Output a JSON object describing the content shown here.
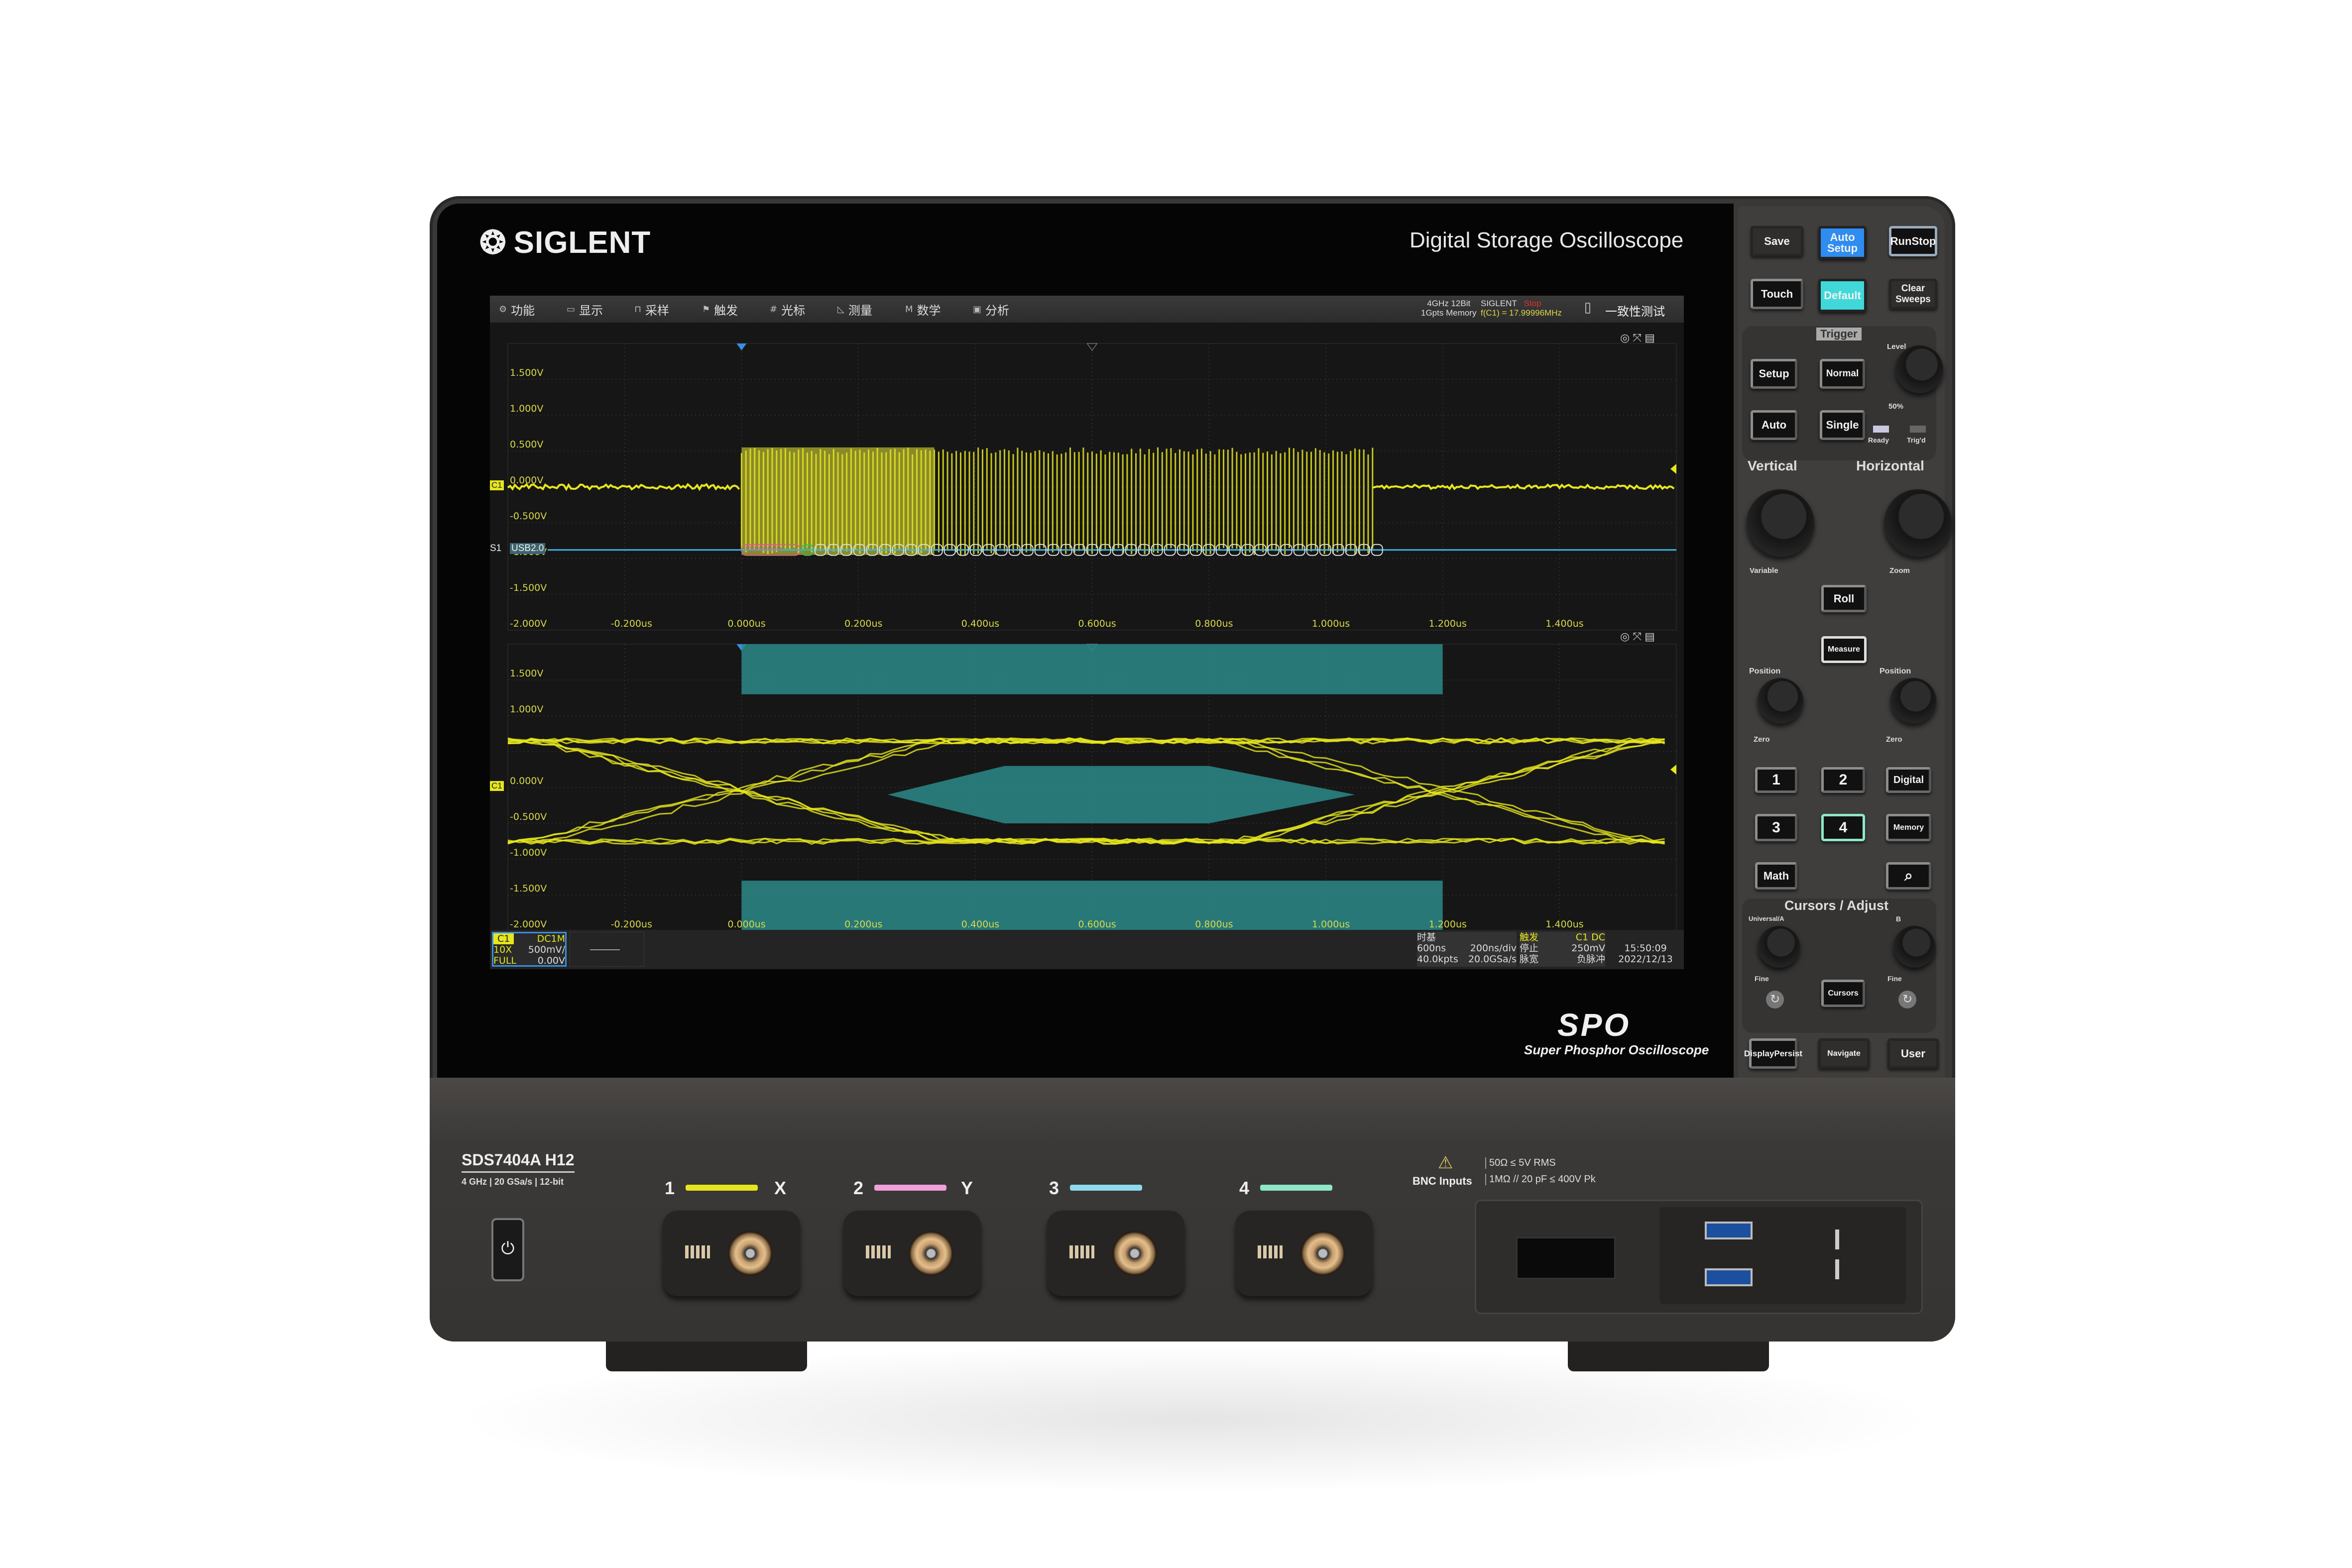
{
  "brand": {
    "logo": "SIGLENT",
    "product_line": "Digital Storage Oscilloscope",
    "spo_logo": "SPO",
    "spo_tagline": "Super Phosphor Oscilloscope"
  },
  "menu": [
    {
      "icon": "gear-icon",
      "glyph": "⚙",
      "label": "功能"
    },
    {
      "icon": "display-icon",
      "glyph": "▭",
      "label": "显示"
    },
    {
      "icon": "acquire-icon",
      "glyph": "⊓",
      "label": "采样"
    },
    {
      "icon": "trigger-flag-icon",
      "glyph": "⚑",
      "label": "触发"
    },
    {
      "icon": "cursor-icon",
      "glyph": "#",
      "label": "光标"
    },
    {
      "icon": "measure-icon",
      "glyph": "◺",
      "label": "测量"
    },
    {
      "icon": "math-icon",
      "glyph": "M",
      "label": "数学"
    },
    {
      "icon": "analysis-icon",
      "glyph": "▣",
      "label": "分析"
    }
  ],
  "header_info": {
    "spec1": "4GHz 12Bit",
    "spec2": "1Gpts Memory",
    "brand": "SIGLENT",
    "run_state": "Stop",
    "frequency": "f(C1) = 17.99996MHz",
    "app": "一致性测试"
  },
  "colors": {
    "ch1": "#e6e61e",
    "ch2": "#f0a0d8",
    "ch3": "#8ed8f0",
    "ch4": "#8ee8c8",
    "serial": "#3cb4e6",
    "mask": "#2a8a88",
    "auto_setup": "#2f8cf0",
    "default": "#40d8d8",
    "stop": "#e03030"
  },
  "plot_top": {
    "y_ticks": [
      "1.500V",
      "1.000V",
      "0.500V",
      "0.000V",
      "-0.500V",
      "-1.000V",
      "-1.500V",
      "-2.000V"
    ],
    "x_ticks": [
      "-0.200us",
      "0.000us",
      "0.200us",
      "0.400us",
      "0.600us",
      "0.800us",
      "1.000us",
      "1.200us",
      "1.400us"
    ],
    "channel_tag": "C1",
    "serial_tag": "S1",
    "serial_protocol": "USB2.0",
    "first_packet": "00000000",
    "packet": "0"
  },
  "plot_bottom": {
    "y_ticks": [
      "1.500V",
      "1.000V",
      "0.000V",
      "-0.500V",
      "-1.000V",
      "-1.500V",
      "-2.000V"
    ],
    "x_ticks": [
      "-0.200us",
      "0.000us",
      "0.200us",
      "0.400us",
      "0.600us",
      "0.800us",
      "1.000us",
      "1.200us",
      "1.400us"
    ],
    "channel_tag": "C1"
  },
  "chart_data": [
    {
      "type": "line",
      "panel": "waveform",
      "xlim_us": [
        -0.4,
        1.6
      ],
      "ylim_V": [
        -2,
        2
      ],
      "grid": true,
      "burst_start_us": 0,
      "burst_end_us": 1.08,
      "burst_high_V": 0.55,
      "burst_low_V": -0.95,
      "baseline_V": 0,
      "serial_decode_level_V": -0.88
    },
    {
      "type": "line",
      "panel": "eye-diagram",
      "xlim_us": [
        -0.4,
        1.6
      ],
      "ylim_V": [
        -2,
        2
      ],
      "grid": true,
      "high_level_V": 0.65,
      "low_level_V": -0.75,
      "crossings_us": [
        0,
        1.2
      ],
      "mask_top_V": [
        1.3,
        2
      ],
      "mask_bottom_V": [
        -2,
        -1.3
      ],
      "mask_center_V": [
        -0.5,
        0.3
      ],
      "mask_x_us": [
        0,
        1.2
      ]
    }
  ],
  "status": {
    "ch": "C1",
    "coupling": "DC1M",
    "probe": "10X",
    "scale": "500mV/",
    "bw": "FULL",
    "offset": "0.00V",
    "timebase_title": "时基",
    "delay": "600ns",
    "tdiv": "200ns/div",
    "points": "40.0kpts",
    "srate": "20.0GSa/s",
    "trig_title": "触发",
    "trig_src": "C1 DC",
    "trig_state": "停止",
    "trig_level": "250mV",
    "trig_type": "脉宽",
    "trig_pol": "负脉冲",
    "time": "15:50:09",
    "date": "2022/12/13"
  },
  "panel": {
    "save": "Save",
    "auto_setup": "Auto Setup",
    "run_stop_top": "Run",
    "run_stop_bottom": "Stop",
    "touch": "Touch",
    "default": "Default",
    "clear_sweeps": "Clear Sweeps",
    "trigger": "Trigger",
    "setup": "Setup",
    "normal": "Normal",
    "auto": "Auto",
    "single": "Single",
    "level": "Level",
    "fifty": "50%",
    "ready": "Ready",
    "trigd": "Trig'd",
    "vertical": "Vertical",
    "horizontal": "Horizontal",
    "variable": "Variable",
    "zoom": "Zoom",
    "roll": "Roll",
    "measure": "Measure",
    "position": "Position",
    "zero": "Zero",
    "ch1": "1",
    "ch2": "2",
    "digital": "Digital",
    "ch3": "3",
    "ch4": "4",
    "memory": "Memory",
    "math": "Math",
    "cursors_adjust": "Cursors / Adjust",
    "universal_a": "Universal/A",
    "b": "B",
    "fine": "Fine",
    "cursors": "Cursors",
    "display_top": "Display",
    "display_bottom": "Persist",
    "navigate": "Navigate",
    "user": "User"
  },
  "front": {
    "model": "SDS7404A  H12",
    "specs": "4 GHz | 20 GSa/s | 12-bit",
    "ch_labels": [
      "1",
      "2",
      "3",
      "4"
    ],
    "x": "X",
    "y": "Y",
    "bnc": "BNC Inputs",
    "bnc_spec1": "50Ω ≤ 5V RMS",
    "bnc_spec2": "1MΩ // 20 pF ≤ 400V Pk"
  }
}
